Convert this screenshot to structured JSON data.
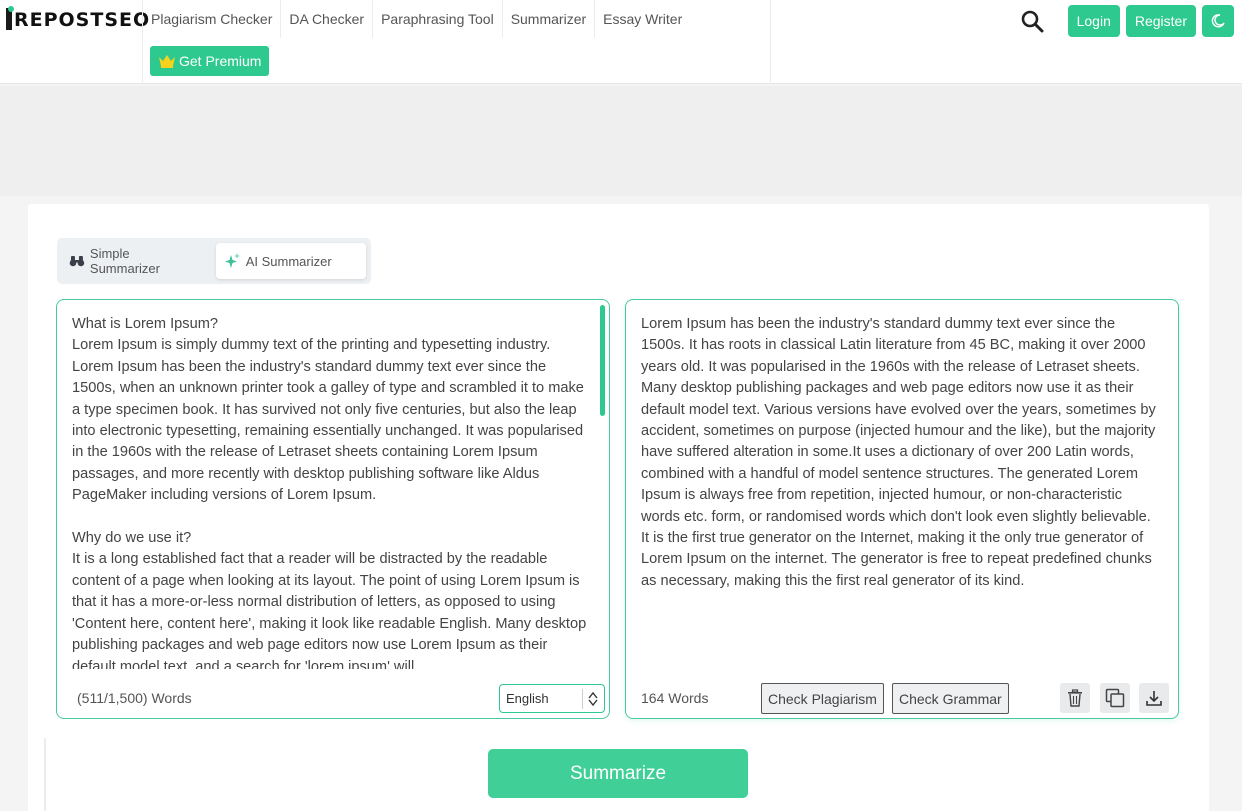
{
  "brand": {
    "logo_text": "REPOSTSEO",
    "accent": "#2ec98f"
  },
  "nav": {
    "items": [
      {
        "label": "Plagiarism Checker"
      },
      {
        "label": "DA Checker"
      },
      {
        "label": "Paraphrasing Tool"
      },
      {
        "label": "Summarizer"
      },
      {
        "label": "Essay Writer"
      }
    ],
    "premium_label": "Get Premium"
  },
  "header_actions": {
    "login_label": "Login",
    "register_label": "Register",
    "icons": [
      "search-icon",
      "moon-icon"
    ]
  },
  "tool": {
    "tabs": [
      {
        "label": "Simple Summarizer",
        "icon": "binoculars-icon",
        "active": false
      },
      {
        "label": "AI Summarizer",
        "icon": "sparkle-icon",
        "active": true
      }
    ],
    "input": {
      "text": "What is Lorem Ipsum?\nLorem Ipsum is simply dummy text of the printing and typesetting industry. Lorem Ipsum has been the industry's standard dummy text ever since the 1500s, when an unknown printer took a galley of type and scrambled it to make a type specimen book. It has survived not only five centuries, but also the leap into electronic typesetting, remaining essentially unchanged. It was popularised in the 1960s with the release of Letraset sheets containing Lorem Ipsum passages, and more recently with desktop publishing software like Aldus PageMaker including versions of Lorem Ipsum.\n\nWhy do we use it?\nIt is a long established fact that a reader will be distracted by the readable content of a page when looking at its layout. The point of using Lorem Ipsum is that it has a more-or-less normal distribution of letters, as opposed to using 'Content here, content here', making it look like readable English. Many desktop publishing packages and web page editors now use Lorem Ipsum as their default model text, and a search for 'lorem ipsum' will",
      "word_count": "(511/1,500) Words",
      "language": "English"
    },
    "output": {
      "text": "Lorem Ipsum has been the industry's standard dummy text ever since the 1500s. It has roots in classical Latin literature from 45 BC, making it over 2000 years old. It was popularised in the 1960s with the release of Letraset sheets. Many desktop publishing packages and web page editors now use it as their default model text. Various versions have evolved over the years, sometimes by accident, sometimes on purpose (injected humour and the like), but the majority have suffered alteration in some.It uses a dictionary of over 200 Latin words, combined with a handful of model sentence structures. The generated Lorem Ipsum is always free from repetition, injected humour, or non-characteristic words etc. form, or randomised words which don't look even slightly believable. It is the first true generator on the Internet, making it the only true generator of Lorem Ipsum on the internet. The generator is free to repeat predefined chunks as necessary, making this the first real generator of its kind.",
      "word_count": "164 Words",
      "check_plagiarism_label": "Check Plagiarism",
      "check_grammar_label": "Check Grammar",
      "icons": [
        "trash-icon",
        "copy-icon",
        "download-icon"
      ]
    },
    "summarize_label": "Summarize"
  }
}
